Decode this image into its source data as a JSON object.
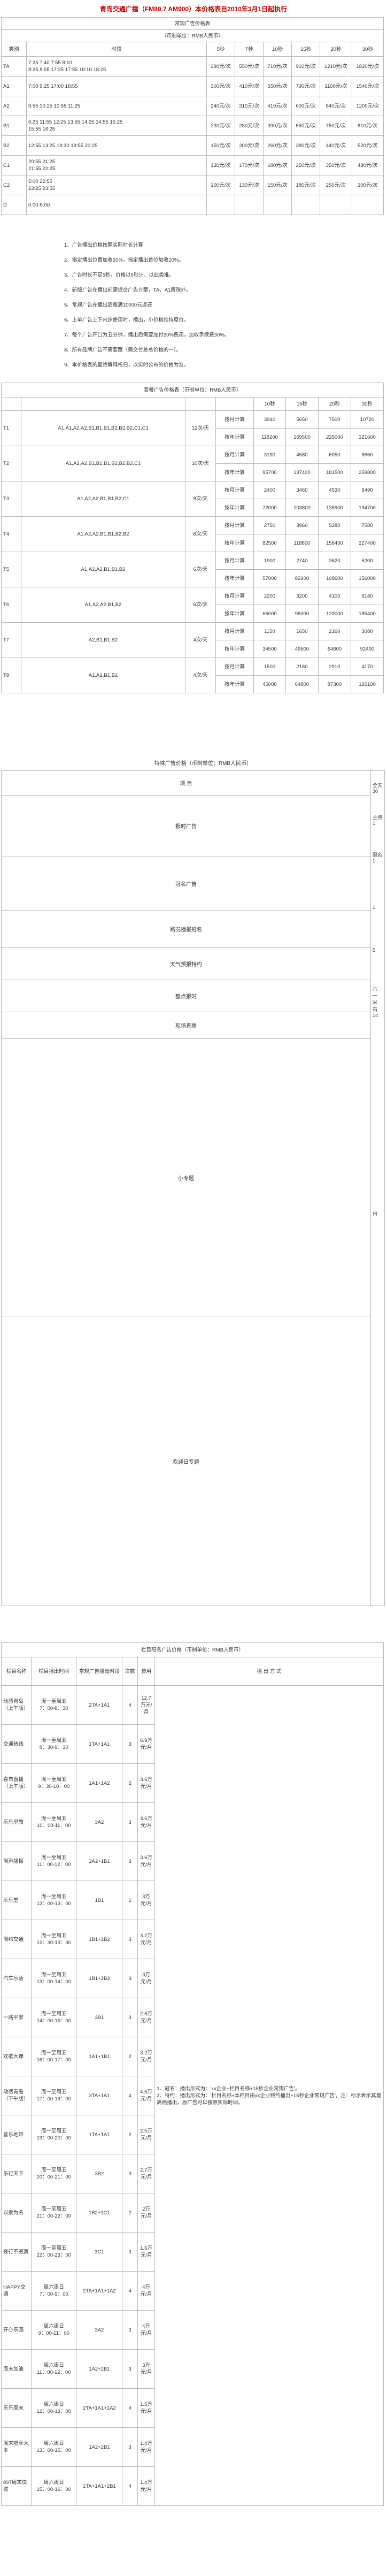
{
  "doc_title": "青岛交通广播（FM89.7 AM900）本价格表自2010年3月1日起执行",
  "t1": {
    "caption": "常规广告价格表",
    "unit": "（币制单位：RMB人民币）",
    "headers": [
      "类别",
      "时段",
      "5秒",
      "7秒",
      "10秒",
      "15秒",
      "20秒",
      "30秒"
    ],
    "rows": [
      {
        "cat": "TA",
        "time": "7:25 7:40 7:55 8:10\n8:25 8:55 17:25 17:55 18:10 18:25",
        "prices": [
          "390元/次",
          "550元/次",
          "710元/次",
          "910元/次",
          "1210元/次",
          "1820元/次"
        ]
      },
      {
        "cat": "A1",
        "time": "7:00 9:25 17:00 18:55",
        "prices": [
          "300元/次",
          "410元/次",
          "550元/次",
          "790元/次",
          "1100元/次",
          "1540元/次"
        ]
      },
      {
        "cat": "A2",
        "time": "9:55 10:25 10:55 11:25",
        "prices": [
          "240元/次",
          "310元/次",
          "410元/次",
          "600元/次",
          "840元/次",
          "1200元/次"
        ]
      },
      {
        "cat": "B1",
        "time": "6:25 11:55 12:25 13:55 14:25 14:55 15:25\n15:55 16:25",
        "prices": [
          "230元/次",
          "280元/次",
          "390元/次",
          "550元/次",
          "760元/次",
          "810元/次"
        ]
      },
      {
        "cat": "B2",
        "time": "12:55 13:25 19:30 19:55 20:25",
        "prices": [
          "150元/次",
          "200元/次",
          "260元/次",
          "380元/次",
          "440元/次",
          "520元/次"
        ]
      },
      {
        "cat": "C1",
        "time": "20:55 21:25\n21:55 22:25",
        "prices": [
          "130元/次",
          "170元/次",
          "180元/次",
          "250元/次",
          "350元/次",
          "480元/次"
        ]
      },
      {
        "cat": "C2",
        "time": "5:00 22:55\n23:25 23:55",
        "prices": [
          "100元/次",
          "130元/次",
          "150元/次",
          "180元/次",
          "250元/次",
          "300元/次"
        ]
      },
      {
        "cat": "D",
        "time": "0:00-5:00",
        "prices": [
          "",
          "",
          "",
          "",
          "",
          ""
        ]
      }
    ]
  },
  "notes": [
    "1、广告播出价格按照实际时长计算",
    "2、指定播出位置加收20%，指定播出首位加收20%。",
    "3、广告时长不足5秒，价格以5秒计，以此类推。",
    "4、新版广告在播出前需提交广告方案，TA、A1段除外。",
    "5、常规广告在播出后每满10000元返还",
    "6、上单广告上下内步使用时，播出，小价格维持原价。",
    "7、每个广告开口为五分钟，播出后需要加付20%费用，加收手续费30%。",
    "8、所有品牌广告不需要跟（需交付总总价格的一）。",
    "9、本价格表的最终解释权归，以实时公布的价格为准。"
  ],
  "t2": {
    "caption": "套餐广告价格表（币制单位：RMB人民币）",
    "headers": [
      "",
      "",
      "",
      "",
      "10秒",
      "15秒",
      "20秒",
      "30秒"
    ],
    "groups": [
      {
        "name": "T1",
        "slots": "A1,A1,A2,A2,B1,B1,B1,B2,B2,B2,C1,C1",
        "freq": "12次/天",
        "rows": [
          [
            "按月计算",
            "3940",
            "5650",
            "7500",
            "10720"
          ],
          [
            "按年计算",
            "118200",
            "169500",
            "225000",
            "321600"
          ]
        ]
      },
      {
        "name": "T2",
        "slots": "A1,A2,A2,B1,B1,B1,B2,B2,B2,C1",
        "freq": "10次/天",
        "rows": [
          [
            "按月计算",
            "3190",
            "4580",
            "6050",
            "8660"
          ],
          [
            "按年计算",
            "95700",
            "137400",
            "181500",
            "259800"
          ]
        ]
      },
      {
        "name": "T3",
        "slots": "A1,A2,A2,B1,B1,B2,C1",
        "freq": "8次/天",
        "rows": [
          [
            "按月计算",
            "2400",
            "3460",
            "4530",
            "6490"
          ],
          [
            "按年计算",
            "72000",
            "103800",
            "135900",
            "194700"
          ]
        ]
      },
      {
        "name": "T4",
        "slots": "A1,A2,A2,B1,B1,B2,B2",
        "freq": "8次/天",
        "rows": [
          [
            "按月计算",
            "2750",
            "3960",
            "5280",
            "7580"
          ],
          [
            "按年计算",
            "82500",
            "118800",
            "158400",
            "227400"
          ]
        ]
      },
      {
        "name": "T5",
        "slots": "A1,A2,A2,B1,B1,B2",
        "freq": "6次/天",
        "rows": [
          [
            "按月计算",
            "1900",
            "2740",
            "3620",
            "5200"
          ],
          [
            "按年计算",
            "57000",
            "82200",
            "108600",
            "156000"
          ]
        ]
      },
      {
        "name": "T6",
        "slots": "A1,A2,A2,B1,B2",
        "freq": "6次/天",
        "rows": [
          [
            "按月计算",
            "2200",
            "3200",
            "4100",
            "6180"
          ],
          [
            "按年计算",
            "66000",
            "96000",
            "129000",
            "185400"
          ]
        ]
      },
      {
        "name": "T7",
        "slots": "A2,B1,B1,B2",
        "freq": "4次/天",
        "rows": [
          [
            "按月计算",
            "1150",
            "1650",
            "2160",
            "3080"
          ],
          [
            "按年计算",
            "34500",
            "49500",
            "64800",
            "92400"
          ]
        ]
      },
      {
        "name": "T8",
        "slots": "A1,A2,B1,B2",
        "freq": "4次/天",
        "rows": [
          [
            "按月计算",
            "1500",
            "2160",
            "2910",
            "4170"
          ],
          [
            "按年计算",
            "45000",
            "64800",
            "87300",
            "125100"
          ]
        ]
      }
    ]
  },
  "t3": {
    "caption": "特殊广告价格（币制单位：RMB人民币）",
    "sections": [
      "项 目",
      "报时广告",
      "冠名广告",
      "路况播报冠名",
      "天气预报特约",
      "整点报时",
      "现场直播",
      "小专题",
      "欢迎日专题"
    ],
    "right_cells": [
      "全天\n30",
      "主持\n1",
      "冠名\n1",
      "1",
      "5",
      "六\n一\n米\n石\n14",
      "内"
    ]
  },
  "t4": {
    "caption": "栏目冠名广告价格（币制单位：RMB人民币）",
    "headers": [
      "栏目名称",
      "栏目播出时间",
      "常规广告播出时段",
      "次数",
      "费用",
      "播 出 方 式"
    ],
    "method": "1、冠名：播出形式为：'xx企业+栏目名称+15秒企业常规广告'。\n2、特约：播出形式为：'栏目名称+本栏目由xx企业特约播出+15秒企业常规广告'，注：标示表示其最高档播出，原广告可以按照实际时间。",
    "rows": [
      {
        "name": "动感青岛（上午版）",
        "time": "周一至周五\n7：00-8：30",
        "slots": "2TA+1A1",
        "count": "4",
        "fee": "12.7万元/月"
      },
      {
        "name": "交通热线",
        "time": "周一至周五\n8：30-9：30",
        "slots": "1TA+1A1",
        "count": "3",
        "fee": "6.9万元/月"
      },
      {
        "name": "喜市直播（上午版）",
        "time": "周一至周五\n9：30-10：00",
        "slots": "1A1+1A2",
        "count": "2",
        "fee": "3.6万元/月"
      },
      {
        "name": "乐乐早教",
        "time": "周一至周五\n10：00-11：00",
        "slots": "3A2",
        "count": "3",
        "fee": "3.6万元/月"
      },
      {
        "name": "简声播报",
        "time": "周一至周五\n11：00-12：00",
        "slots": "2A2+1B1",
        "count": "3",
        "fee": "3.6万元/月"
      },
      {
        "name": "乐乐堂",
        "time": "周一至周五\n12：00-13：00",
        "slots": "1B1",
        "count": "1",
        "fee": "3万元/月"
      },
      {
        "name": "简约交通",
        "time": "周一至周五\n12：30-13：30",
        "slots": "1B1+2B2",
        "count": "3",
        "fee": "3.2万元/月"
      },
      {
        "name": "汽车乐活",
        "time": "周一至周五\n13：00-14：00",
        "slots": "1B1+2B2",
        "count": "3",
        "fee": "3万元/月"
      },
      {
        "name": "一路平安",
        "time": "周一至周五\n14：00-16：00",
        "slots": "3B1",
        "count": "3",
        "fee": "2.6万元/月"
      },
      {
        "name": "欢歌大课",
        "time": "周一至周五\n16：00-17：00",
        "slots": "1A1+1B1",
        "count": "2",
        "fee": "3.2万元/月"
      },
      {
        "name": "动感青岛（下午版）",
        "time": "周一至周五\n17：00-19：00",
        "slots": "3TA+1A1",
        "count": "4",
        "fee": "4.5万元/月"
      },
      {
        "name": "音乐地带",
        "time": "周一至周五\n19：00-20：00",
        "slots": "1TA+1A1",
        "count": "2",
        "fee": "2.5万元/月"
      },
      {
        "name": "乐行天下",
        "time": "周一至周五\n20：00-21：00",
        "slots": "3B2",
        "count": "3",
        "fee": "2.7万元/月"
      },
      {
        "name": "以爱为名",
        "time": "周一至周五\n21：00-22：00",
        "slots": "1B2+1C1",
        "count": "2",
        "fee": "2万元/月"
      },
      {
        "name": "夜行不寂寞",
        "time": "周一至周五\n22：00-23：00",
        "slots": "3C1",
        "count": "3",
        "fee": "1.6万元/月"
      },
      {
        "name": "HAPPY交通",
        "time": "周六周日\n7：00-9：00",
        "slots": "2TA+1A1+1A2",
        "count": "4",
        "fee": "4万元/月"
      },
      {
        "name": "开心乐园",
        "time": "周六周日\n9：00-11：00",
        "slots": "3A2",
        "count": "3",
        "fee": "4万元/月"
      },
      {
        "name": "周末加油",
        "time": "周六周日\n11：00-12：00",
        "slots": "1A2+2B1",
        "count": "3",
        "fee": "3万元/月"
      },
      {
        "name": "乐乐周末",
        "time": "周六周日\n12：00-13：00",
        "slots": "2TA+1A1+1A2",
        "count": "4",
        "fee": "1.5万元/月"
      },
      {
        "name": "周末唱享大本",
        "time": "周六周日\n13：00-15：00",
        "slots": "1A2+2B1",
        "count": "3",
        "fee": "1.4万元/月"
      },
      {
        "name": "897周末快递",
        "time": "周六周日\n15：00-16：00",
        "slots": "1TA+1A1+2B1",
        "count": "4",
        "fee": "1.4万元/月"
      }
    ]
  }
}
